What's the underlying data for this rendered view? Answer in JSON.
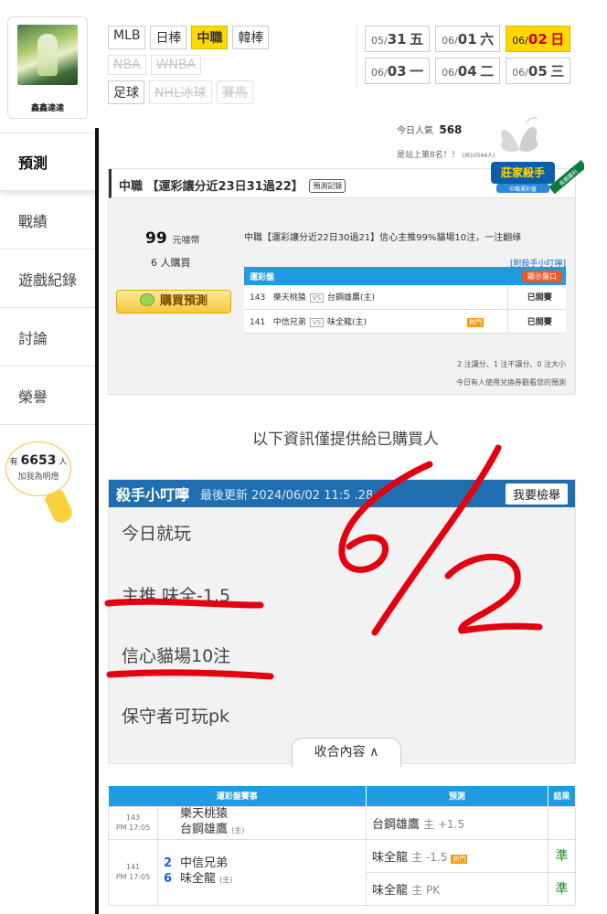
{
  "sidebar": {
    "username": "鑫鑫達達",
    "items": [
      {
        "label": "預測",
        "active": true
      },
      {
        "label": "戰績"
      },
      {
        "label": "遊戲紀錄"
      },
      {
        "label": "討論"
      },
      {
        "label": "榮譽"
      }
    ],
    "popularity": {
      "prefix": "有",
      "count": "6653",
      "suffix": "人",
      "sub": "加我為明燈"
    }
  },
  "filters": {
    "row1": [
      {
        "label": "MLB"
      },
      {
        "label": "日棒"
      },
      {
        "label": "中職",
        "selected": true
      },
      {
        "label": "韓棒"
      }
    ],
    "row2": [
      {
        "label": "NBA",
        "disabled": true
      },
      {
        "label": "WNBA",
        "disabled": true
      }
    ],
    "row3": [
      {
        "label": "足球"
      },
      {
        "label": "NHL冰球",
        "disabled": true
      },
      {
        "label": "賽馬",
        "disabled": true
      }
    ]
  },
  "dates": {
    "row1": [
      {
        "md": "05/",
        "d": "31",
        "w": "五"
      },
      {
        "md": "06/",
        "d": "01",
        "w": "六"
      },
      {
        "md": "06/",
        "d": "02",
        "w": "日",
        "selected": true
      }
    ],
    "row2": [
      {
        "md": "06/",
        "d": "03",
        "w": "一"
      },
      {
        "md": "06/",
        "d": "04",
        "w": "二"
      },
      {
        "md": "06/",
        "d": "05",
        "w": "三"
      }
    ]
  },
  "popularity_today": {
    "label": "今日人氣",
    "value": "568",
    "rank": "是站上第8名！！",
    "rank_sub": "(共10544人)"
  },
  "prediction": {
    "title": "中職 【運彩讓分近23日31過22】",
    "record_btn": "預測記錄",
    "badge": "莊家殺手",
    "badge_sub": "中職運彩盤",
    "badge_ribbon": "長期獲利",
    "price": "99",
    "price_unit": "元噱幣",
    "buyers": "6 人購買",
    "buy_btn": "購買預測",
    "desc": "中職【運彩讓分近22日30過21】信心主推99%貓場10注，一注翻綠",
    "note": "[附殺手小叮嚀]",
    "table_header": "運彩盤",
    "show_btn": "顯示盤口",
    "rows": [
      {
        "gid": "143",
        "away": "樂天桃猿",
        "home": "台鋼雄鷹(主)",
        "result": "已開賽",
        "hot": false
      },
      {
        "gid": "141",
        "away": "中信兄弟",
        "home": "味全龍(主)",
        "result": "已開賽",
        "hot": true
      }
    ],
    "vs": "VS",
    "hot_label": "熱門",
    "foot1": "2 注讓分、1 注不讓分、0 注大小",
    "foot2": "今日有人使用兌換券觀看您的預測"
  },
  "buyers_only": "以下資訊僅提供給已購買人",
  "tips": {
    "title": "殺手小叮嚀",
    "updated": "最後更新 2024/06/02 11:5 .28",
    "report_btn": "我要檢舉",
    "lines": [
      "今日就玩",
      "主推 味全-1.5",
      "信心貓場10注",
      "保守者可玩pk"
    ],
    "collapse_btn": "收合內容 ∧"
  },
  "results": {
    "headers": [
      "運彩盤賽事",
      "預測",
      "結果"
    ],
    "games": [
      {
        "gid": "143",
        "time": "PM 17:05",
        "away": "樂天桃猿",
        "home": "台鋼雄鷹",
        "home_tag": "(主)",
        "away_score": "",
        "home_score": "",
        "picks": [
          {
            "team": "台鋼雄鷹",
            "hand": "主 +1.5",
            "hot": false,
            "result": ""
          }
        ]
      },
      {
        "gid": "141",
        "time": "PM 17:05",
        "away": "中信兄弟",
        "home": "味全龍",
        "home_tag": "(主)",
        "away_score": "2",
        "home_score": "6",
        "picks": [
          {
            "team": "味全龍",
            "hand": "主 -1.5",
            "hot": true,
            "result": "準"
          },
          {
            "team": "味全龍",
            "hand": "主 PK",
            "hot": false,
            "result": "準"
          }
        ]
      }
    ]
  },
  "handwriting": "6/2",
  "colors": {
    "accent": "#ffd800",
    "header_blue": "#1f6fb0",
    "table_blue": "#1f9be0",
    "ink_red": "#e3000f",
    "win_green": "#1d8a1d"
  }
}
